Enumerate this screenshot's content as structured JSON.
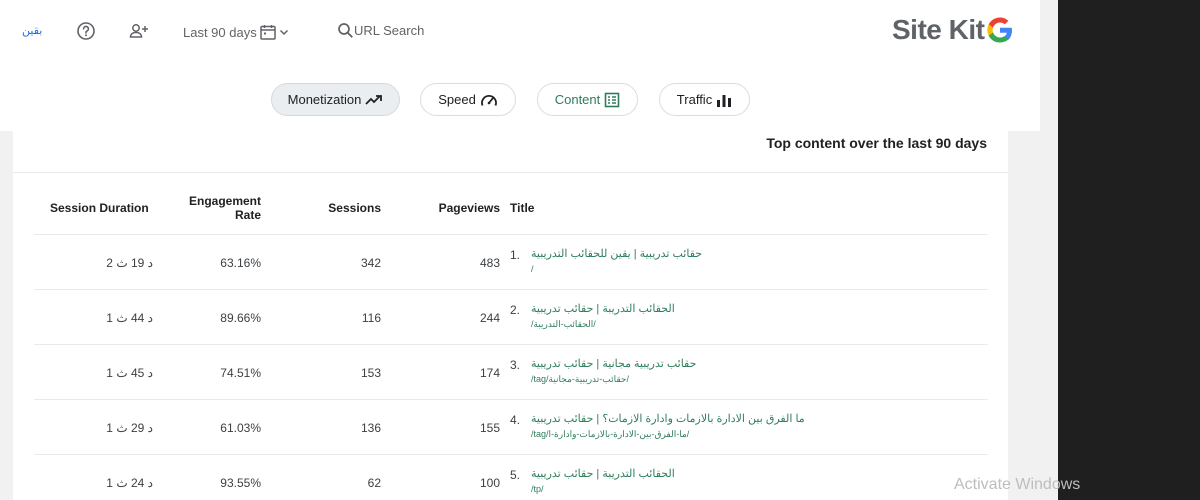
{
  "header": {
    "language_link": "بقين",
    "date_range": "Last 90 days",
    "url_search": "URL Search",
    "logo_text": "Site Kit"
  },
  "chips": [
    {
      "label": "Monetization",
      "icon": "trending-up-icon",
      "active": true
    },
    {
      "label": "Speed",
      "icon": "speedometer-icon",
      "active": false
    },
    {
      "label": "Content",
      "icon": "list-doc-icon",
      "active": false
    },
    {
      "label": "Traffic",
      "icon": "bar-chart-icon",
      "active": false
    }
  ],
  "card": {
    "title": "Top content over the last 90 days",
    "columns": {
      "session_duration": "Session Duration",
      "engagement_rate": "Engagement Rate",
      "sessions": "Sessions",
      "pageviews": "Pageviews",
      "title": "Title"
    },
    "rows": [
      {
        "rank": "1.",
        "title": "حقائب تدريبية | يقين للحقائب التدريبية",
        "url": "/",
        "pageviews": "483",
        "sessions": "342",
        "engagement": "63.16%",
        "duration": "2 د 19 ث"
      },
      {
        "rank": "2.",
        "title": "الحقائب التدريبة | حقائب تدريبية",
        "url": "/الحقائب-التدريبة/",
        "pageviews": "244",
        "sessions": "116",
        "engagement": "89.66%",
        "duration": "1 د 44 ث"
      },
      {
        "rank": "3.",
        "title": "حقائب تدريبية مجانية | حقائب تدريبية",
        "url": "/tag/حقائب-تدريبية-مجانية/",
        "pageviews": "174",
        "sessions": "153",
        "engagement": "74.51%",
        "duration": "1 د 45 ث"
      },
      {
        "rank": "4.",
        "title": "ما الفرق بين الادارة بالازمات وادارة الازمات؟ | حقائب تدريبية",
        "url": "/tag/ما-الفرق-بين-الادارة-بالازمات-وادارة-ا/",
        "pageviews": "155",
        "sessions": "136",
        "engagement": "61.03%",
        "duration": "1 د 29 ث"
      },
      {
        "rank": "5.",
        "title": "الحقائب التدريبة | حقائب تدريبية",
        "url": "/tp/",
        "pageviews": "100",
        "sessions": "62",
        "engagement": "93.55%",
        "duration": "1 د 24 ث"
      }
    ]
  },
  "watermark": "Activate Windows",
  "colors": {
    "link": "#2e7d5b",
    "accent": "#1a73e8"
  }
}
